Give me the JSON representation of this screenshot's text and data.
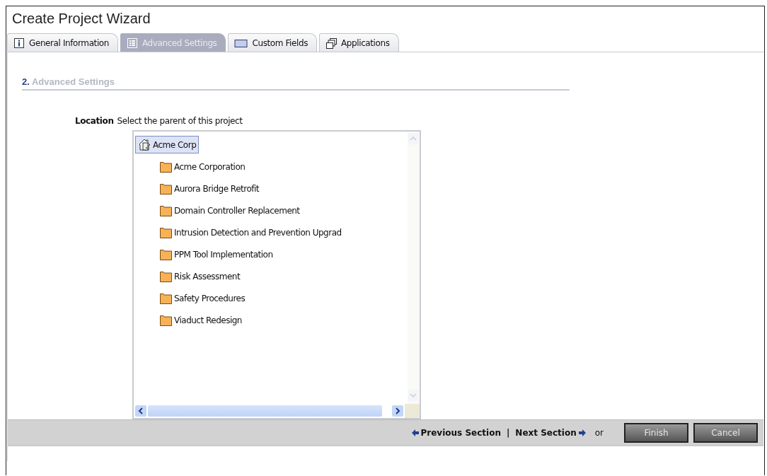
{
  "window": {
    "title": "Create Project Wizard"
  },
  "tabs": [
    {
      "label": "General Information",
      "kind": "info",
      "selected": false
    },
    {
      "label": "Advanced Settings",
      "kind": "list",
      "selected": true
    },
    {
      "label": "Custom Fields",
      "kind": "field",
      "selected": false
    },
    {
      "label": "Applications",
      "kind": "windows",
      "selected": false
    }
  ],
  "section": {
    "number": "2.",
    "title": "Advanced Settings"
  },
  "location": {
    "label": "Location",
    "hint": "Select the parent of this project"
  },
  "tree": [
    {
      "label": "Acme Corp",
      "kind": "root",
      "selected": true,
      "children": [
        {
          "label": "Acme Corporation",
          "kind": "folder",
          "selected": false
        },
        {
          "label": "Aurora Bridge Retrofit",
          "kind": "folder",
          "selected": false
        },
        {
          "label": "Domain Controller Replacement",
          "kind": "folder",
          "selected": false
        },
        {
          "label": "Intrusion Detection and Prevention Upgrad",
          "kind": "folder",
          "selected": false
        },
        {
          "label": "PPM Tool Implementation",
          "kind": "folder",
          "selected": false
        },
        {
          "label": "Risk Assessment",
          "kind": "folder",
          "selected": false
        },
        {
          "label": "Safety Procedures",
          "kind": "folder",
          "selected": false
        },
        {
          "label": "Viaduct Redesign",
          "kind": "folder",
          "selected": false
        }
      ]
    }
  ],
  "footer": {
    "previous": "Previous Section",
    "separator": "|",
    "next": "Next Section",
    "or": "or",
    "buttons": [
      "Finish",
      "Cancel"
    ]
  }
}
